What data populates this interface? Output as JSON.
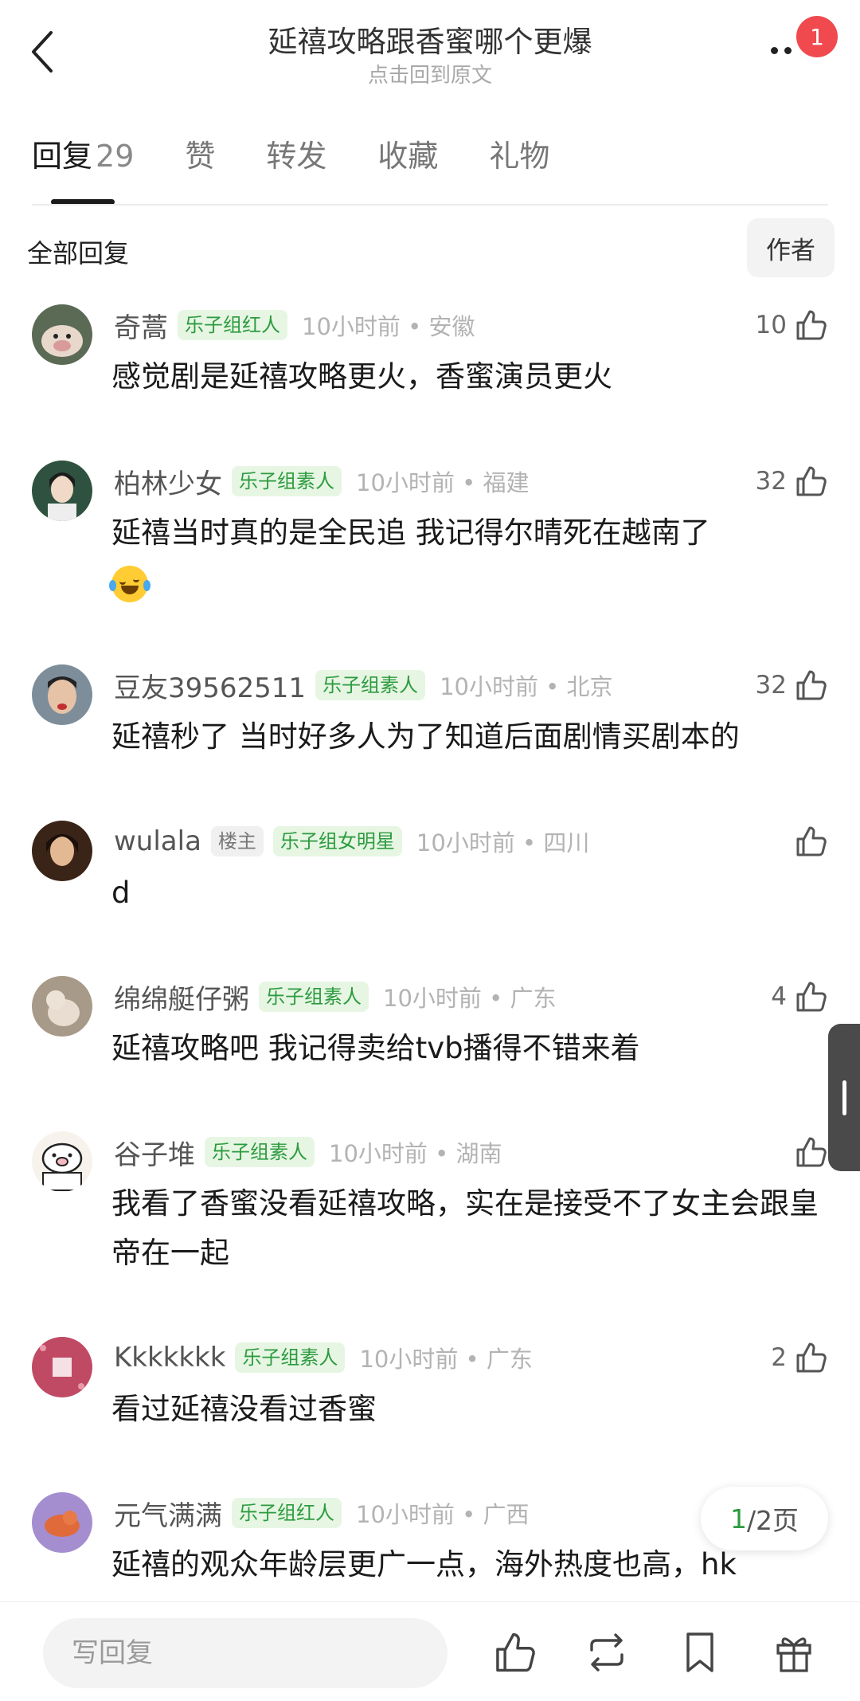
{
  "header": {
    "title": "延禧攻略跟香蜜哪个更爆",
    "subtitle": "点击回到原文",
    "notification_count": "1"
  },
  "tabs": [
    {
      "label": "回复",
      "count": "29",
      "active": true
    },
    {
      "label": "赞",
      "count": ""
    },
    {
      "label": "转发",
      "count": ""
    },
    {
      "label": "收藏",
      "count": ""
    },
    {
      "label": "礼物",
      "count": ""
    }
  ],
  "filter": {
    "label": "全部回复",
    "author_button": "作者"
  },
  "comments": [
    {
      "username": "奇蒿",
      "tag": "乐子组红人",
      "time": "10小时前 • 安徽",
      "likes": "10",
      "text": "感觉剧是延禧攻略更火，香蜜演员更火",
      "avatar_color": "#8a7a6a"
    },
    {
      "username": "柏林少女",
      "tag": "乐子组素人",
      "time": "10小时前 • 福建",
      "likes": "32",
      "text": "延禧当时真的是全民追  我记得尔晴死在越南了",
      "emoji": "laughing-with-tears",
      "avatar_color": "#3b5a48"
    },
    {
      "username": "豆友39562511",
      "tag": "乐子组素人",
      "time": "10小时前 • 北京",
      "likes": "32",
      "text": "延禧秒了 当时好多人为了知道后面剧情买剧本的",
      "avatar_color": "#6a7c8a"
    },
    {
      "username": "wulala",
      "owner_tag": "楼主",
      "tag": "乐子组女明星",
      "time": "10小时前 • 四川",
      "likes": "",
      "text": "d",
      "avatar_color": "#5a3a28"
    },
    {
      "username": "绵绵艇仔粥",
      "tag": "乐子组素人",
      "time": "10小时前 • 广东",
      "likes": "4",
      "text": "延禧攻略吧 我记得卖给tvb播得不错来着",
      "avatar_color": "#b9ab98"
    },
    {
      "username": "谷子堆",
      "tag": "乐子组素人",
      "time": "10小时前 • 湖南",
      "likes": "",
      "text": "我看了香蜜没看延禧攻略，实在是接受不了女主会跟皇帝在一起",
      "avatar_color": "#f5f1ea"
    },
    {
      "username": "Kkkkkkk",
      "tag": "乐子组素人",
      "time": "10小时前 • 广东",
      "likes": "2",
      "text": "看过延禧没看过香蜜",
      "avatar_color": "#c0506a"
    },
    {
      "username": "元气满满",
      "tag": "乐子组红人",
      "time": "10小时前 • 广西",
      "likes": "",
      "text": "延禧的观众年龄层更广一点，海外热度也高，hk",
      "avatar_color": "#9a84c8"
    }
  ],
  "page_indicator": {
    "current": "1",
    "total": "/2页"
  },
  "bottom_bar": {
    "reply_placeholder": "写回复"
  },
  "colors": {
    "tag_green": "#2d9b3f",
    "tag_bg": "#e6f6e3",
    "badge_red": "#f04a4f"
  }
}
